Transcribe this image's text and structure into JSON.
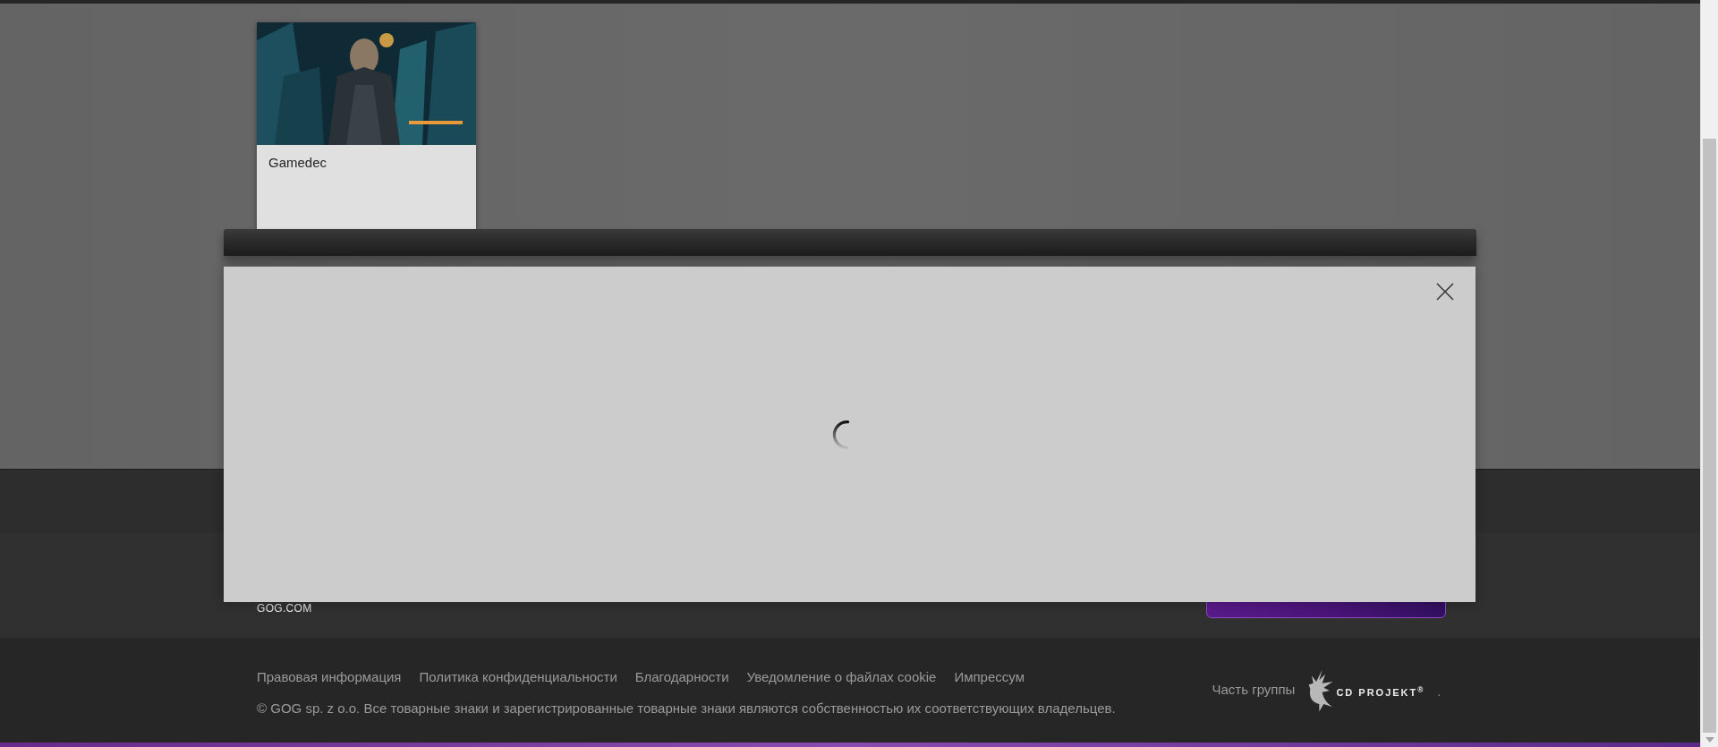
{
  "shelf": {
    "games": [
      {
        "title": "Gamedec"
      }
    ]
  },
  "footer": {
    "site_label": "GOG.COM",
    "links": [
      "Правовая информация",
      "Политика конфиденциальности",
      "Благодарности",
      "Уведомление о файлах cookie",
      "Импрессум"
    ],
    "copyright": "© GOG sp. z o.o. Все товарные знаки и зарегистрированные товарные знаки являются собственностью их соответствующих владельцев.",
    "group_label": "Часть группы",
    "group_logo": "CD PROJEKT$^{®}$",
    "group_suffix": "."
  },
  "modal": {
    "loading": true
  }
}
